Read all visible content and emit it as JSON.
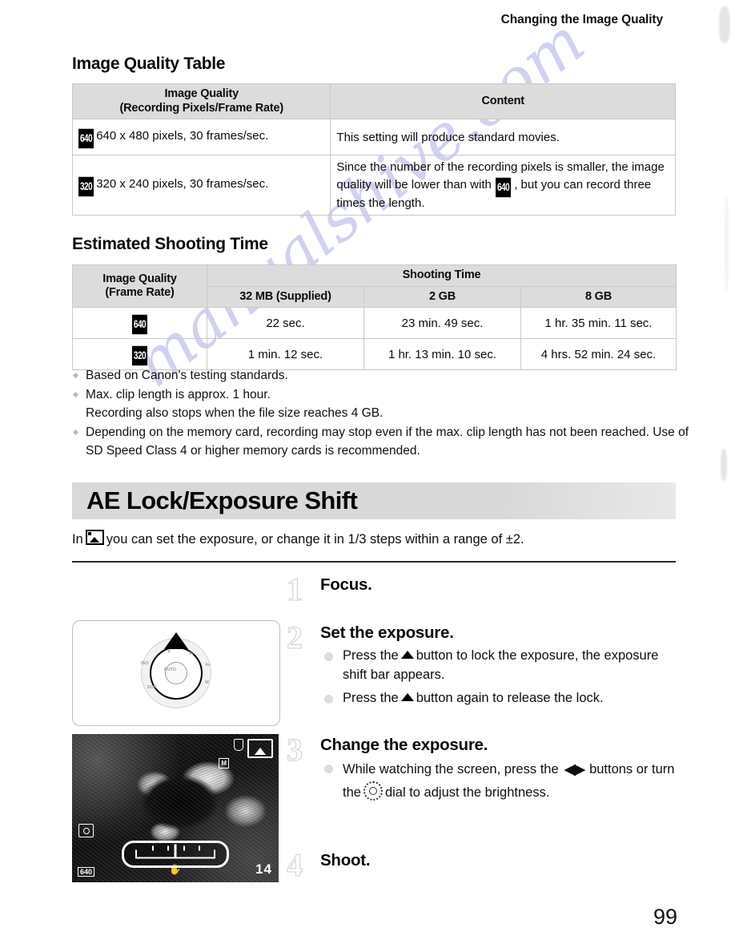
{
  "header": {
    "running_title": "Changing the Image Quality"
  },
  "watermark": {
    "text": "manualshive.com"
  },
  "sections": {
    "image_quality_table": {
      "heading": "Image Quality Table",
      "columns": {
        "quality_line1": "Image Quality",
        "quality_line2": "(Recording Pixels/Frame Rate)",
        "content": "Content"
      },
      "rows": [
        {
          "badge": "640",
          "spec": "640 x 480 pixels, 30 frames/sec.",
          "content": "This setting will produce standard movies."
        },
        {
          "badge": "320",
          "spec": "320 x 240 pixels, 30 frames/sec.",
          "content_part1": "Since the number of the recording pixels is smaller, the image quality will be lower than with",
          "content_badge": "640",
          "content_part2": ", but you can record three times the length."
        }
      ]
    },
    "estimated_shooting_time": {
      "heading": "Estimated Shooting Time",
      "columns": {
        "quality_line1": "Image Quality",
        "quality_line2": "(Frame Rate)",
        "shooting_time": "Shooting Time",
        "c_32mb": "32 MB (Supplied)",
        "c_2gb": "2 GB",
        "c_8gb": "8 GB"
      },
      "rows": [
        {
          "badge": "640",
          "v_32mb": "22 sec.",
          "v_2gb": "23 min. 49 sec.",
          "v_8gb": "1 hr. 35 min. 11 sec."
        },
        {
          "badge": "320",
          "v_32mb": "1 min. 12 sec.",
          "v_2gb": "1 hr. 13 min. 10 sec.",
          "v_8gb": "4 hrs. 52 min. 24 sec."
        }
      ]
    },
    "notes": [
      "Based on Canon's testing standards.",
      "Max. clip length is approx. 1 hour.\nRecording also stops when the file size reaches 4 GB.",
      "Depending on the memory card, recording may stop even if the max. clip length has not been reached. Use of SD Speed Class 4 or higher memory cards is recommended."
    ],
    "ae_lock": {
      "banner_title": "AE Lock/Exposure Shift",
      "intro_before": "In",
      "intro_after": "you can set the exposure, or change it in 1/3 steps within a range of ±2.",
      "steps": [
        {
          "number": "1",
          "title": "Focus.",
          "bullets": []
        },
        {
          "number": "2",
          "title": "Set the exposure.",
          "bullets": [
            {
              "before": "Press the",
              "after": "button to lock the exposure, the exposure shift bar appears."
            },
            {
              "before": "Press the",
              "after": "button again to release the lock."
            }
          ]
        },
        {
          "number": "3",
          "title": "Change the exposure.",
          "bullets": [
            {
              "before": "While watching the screen, press the",
              "mid": "buttons or turn the",
              "after": "dial to adjust the brightness."
            }
          ]
        },
        {
          "number": "4",
          "title": "Shoot.",
          "bullets": []
        }
      ]
    }
  },
  "figures": {
    "dial": {
      "marks": [
        "P",
        "Tv",
        "Av",
        "M",
        "SCN",
        "AUTO",
        "ISO"
      ]
    },
    "lcd": {
      "osd_quality_badge": "M",
      "osd_resolution": "640",
      "osd_hand_icon": "✋",
      "osd_shots_remaining": "14"
    }
  },
  "footer": {
    "page_number": "99"
  }
}
